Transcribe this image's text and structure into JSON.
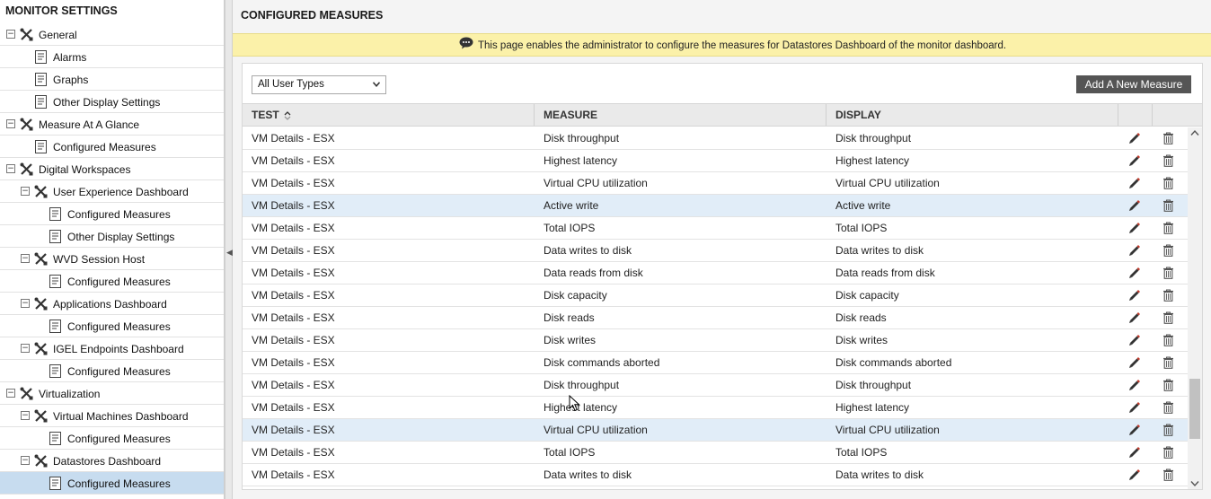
{
  "sidebar": {
    "title": "MONITOR SETTINGS",
    "items": [
      {
        "label": "General",
        "type": "group",
        "level": 0,
        "toggle": "⊟"
      },
      {
        "label": "Alarms",
        "type": "page",
        "level": 1
      },
      {
        "label": "Graphs",
        "type": "page",
        "level": 1
      },
      {
        "label": "Other Display Settings",
        "type": "page",
        "level": 1
      },
      {
        "label": "Measure At A Glance",
        "type": "group",
        "level": 0,
        "toggle": "⊟"
      },
      {
        "label": "Configured Measures",
        "type": "page",
        "level": 1
      },
      {
        "label": "Digital Workspaces",
        "type": "group",
        "level": 0,
        "toggle": "⊟"
      },
      {
        "label": "User Experience Dashboard",
        "type": "group",
        "level": 1,
        "toggle": "⊟"
      },
      {
        "label": "Configured Measures",
        "type": "page",
        "level": 2
      },
      {
        "label": "Other Display Settings",
        "type": "page",
        "level": 2
      },
      {
        "label": "WVD Session Host",
        "type": "group",
        "level": 1,
        "toggle": "⊟"
      },
      {
        "label": "Configured Measures",
        "type": "page",
        "level": 2
      },
      {
        "label": "Applications Dashboard",
        "type": "group",
        "level": 1,
        "toggle": "⊟"
      },
      {
        "label": "Configured Measures",
        "type": "page",
        "level": 2
      },
      {
        "label": "IGEL Endpoints Dashboard",
        "type": "group",
        "level": 1,
        "toggle": "⊟"
      },
      {
        "label": "Configured Measures",
        "type": "page",
        "level": 2
      },
      {
        "label": "Virtualization",
        "type": "group",
        "level": 0,
        "toggle": "⊟"
      },
      {
        "label": "Virtual Machines Dashboard",
        "type": "group",
        "level": 1,
        "toggle": "⊟"
      },
      {
        "label": "Configured Measures",
        "type": "page",
        "level": 2
      },
      {
        "label": "Datastores Dashboard",
        "type": "group",
        "level": 1,
        "toggle": "⊟"
      },
      {
        "label": "Configured Measures",
        "type": "page",
        "level": 2,
        "selected": true
      }
    ]
  },
  "main": {
    "title": "CONFIGURED MEASURES",
    "info_text": "This page enables the administrator to configure the measures for Datastores Dashboard of the monitor dashboard.",
    "filter": {
      "selected": "All User Types"
    },
    "add_button": "Add A New Measure",
    "columns": [
      "TEST",
      "MEASURE",
      "DISPLAY"
    ],
    "rows": [
      {
        "test": "VM Details - ESX",
        "measure": "Disk throughput",
        "display": "Disk throughput"
      },
      {
        "test": "VM Details - ESX",
        "measure": "Highest latency",
        "display": "Highest latency"
      },
      {
        "test": "VM Details - ESX",
        "measure": "Virtual CPU utilization",
        "display": "Virtual CPU utilization"
      },
      {
        "test": "VM Details - ESX",
        "measure": "Active write",
        "display": "Active write",
        "highlight": true
      },
      {
        "test": "VM Details - ESX",
        "measure": "Total IOPS",
        "display": "Total IOPS"
      },
      {
        "test": "VM Details - ESX",
        "measure": "Data writes to disk",
        "display": "Data writes to disk"
      },
      {
        "test": "VM Details - ESX",
        "measure": "Data reads from disk",
        "display": "Data reads from disk"
      },
      {
        "test": "VM Details - ESX",
        "measure": "Disk capacity",
        "display": "Disk capacity"
      },
      {
        "test": "VM Details - ESX",
        "measure": "Disk reads",
        "display": "Disk reads"
      },
      {
        "test": "VM Details - ESX",
        "measure": "Disk writes",
        "display": "Disk writes"
      },
      {
        "test": "VM Details - ESX",
        "measure": "Disk commands aborted",
        "display": "Disk commands aborted"
      },
      {
        "test": "VM Details - ESX",
        "measure": "Disk throughput",
        "display": "Disk throughput"
      },
      {
        "test": "VM Details - ESX",
        "measure": "Highest latency",
        "display": "Highest latency"
      },
      {
        "test": "VM Details - ESX",
        "measure": "Virtual CPU utilization",
        "display": "Virtual CPU utilization",
        "highlight": true
      },
      {
        "test": "VM Details - ESX",
        "measure": "Total IOPS",
        "display": "Total IOPS"
      },
      {
        "test": "VM Details - ESX",
        "measure": "Data writes to disk",
        "display": "Data writes to disk"
      }
    ]
  },
  "colors": {
    "info_bar": "#fbf1a9",
    "selected_item": "#c7dcef",
    "highlight_row": "#e1edf8",
    "edit_icon": "#c0392b",
    "button": "#555555"
  },
  "icons": {
    "group": "tools-icon",
    "page": "page-icon",
    "edit": "pencil-icon",
    "delete": "trash-icon",
    "info": "comment-icon"
  }
}
